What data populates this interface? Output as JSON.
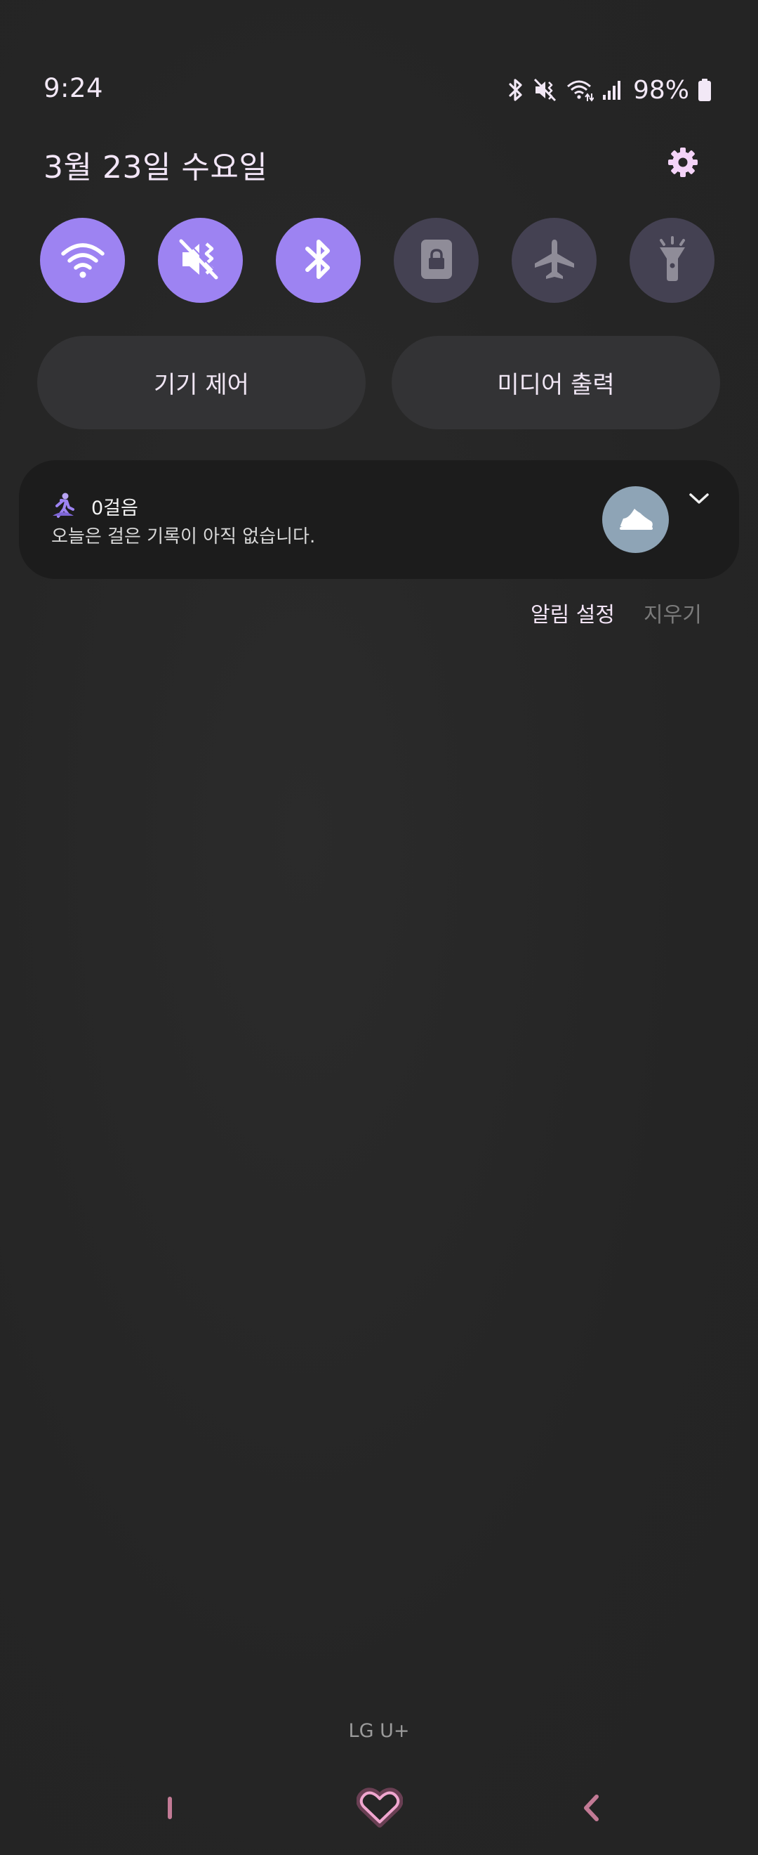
{
  "status_bar": {
    "time": "9:24",
    "battery_percent": "98%",
    "icons": [
      "bluetooth-icon",
      "mute-vibrate-icon",
      "wifi-icon",
      "signal-icon",
      "battery-icon"
    ]
  },
  "panel": {
    "date": "3월 23일 수요일",
    "settings_icon": "gear-icon"
  },
  "quick_tiles": [
    {
      "name": "wifi",
      "icon": "wifi-icon",
      "active": true
    },
    {
      "name": "sound",
      "icon": "mute-vibrate-icon",
      "active": true
    },
    {
      "name": "bluetooth",
      "icon": "bluetooth-icon",
      "active": true
    },
    {
      "name": "auto-rotate",
      "icon": "rotation-lock-icon",
      "active": false
    },
    {
      "name": "airplane-mode",
      "icon": "airplane-icon",
      "active": false
    },
    {
      "name": "flashlight",
      "icon": "flashlight-icon",
      "active": false
    }
  ],
  "buttons": {
    "device_control": "기기 제어",
    "media_output": "미디어 출력"
  },
  "notification": {
    "title": "0걸음",
    "body": "오늘은 걸은 기록이 아직 없습니다.",
    "app_icon": "walking-person-icon",
    "action_icon": "sneaker-icon"
  },
  "notification_footer": {
    "settings": "알림 설정",
    "clear": "지우기"
  },
  "carrier": "LG U+",
  "nav_bar": {
    "recent_icon": "recent-apps-icon",
    "home_icon": "heart-home-icon",
    "back_icon": "back-icon"
  },
  "colors": {
    "accent": "#9d83f2",
    "tile_off": "#444152",
    "background": "#262626",
    "card": "#1c1c1c",
    "nav_pink": "#c27a95"
  }
}
